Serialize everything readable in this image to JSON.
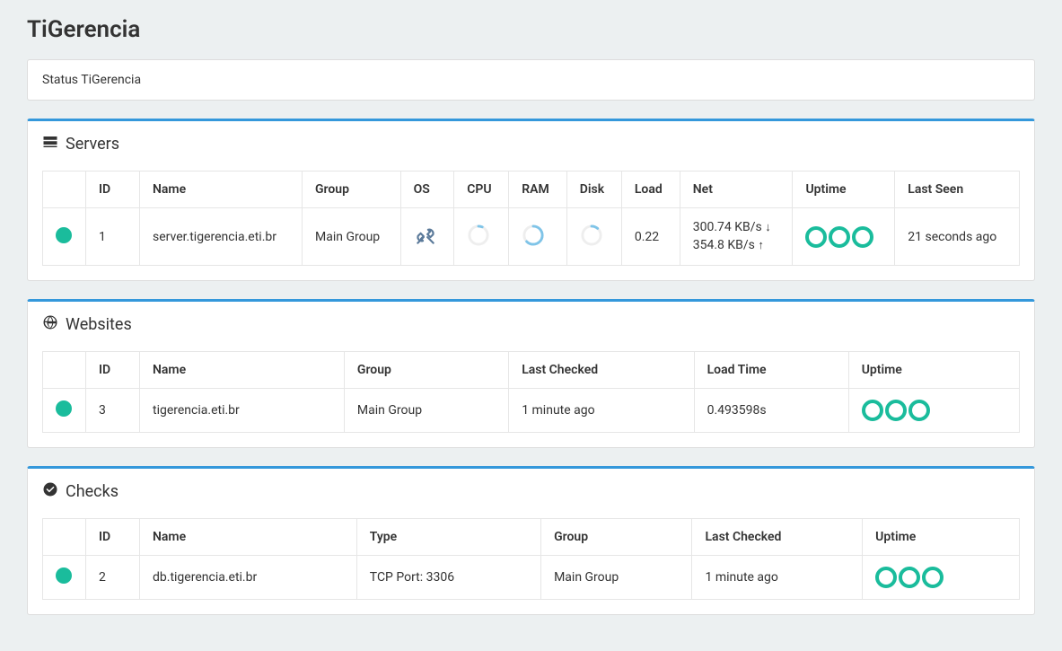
{
  "page": {
    "title": "TiGerencia",
    "status_label": "Status TiGerencia"
  },
  "servers_section": {
    "heading": "Servers",
    "columns": {
      "id": "ID",
      "name": "Name",
      "group": "Group",
      "os": "OS",
      "cpu": "CPU",
      "ram": "RAM",
      "disk": "Disk",
      "load": "Load",
      "net": "Net",
      "uptime": "Uptime",
      "last_seen": "Last Seen"
    },
    "rows": [
      {
        "id": "1",
        "name": "server.tigerencia.eti.br",
        "group": "Main Group",
        "load": "0.22",
        "net_down": "300.74 KB/s",
        "net_up": "354.8 KB/s",
        "last_seen": "21 seconds ago"
      }
    ]
  },
  "websites_section": {
    "heading": "Websites",
    "columns": {
      "id": "ID",
      "name": "Name",
      "group": "Group",
      "last_checked": "Last Checked",
      "load_time": "Load Time",
      "uptime": "Uptime"
    },
    "rows": [
      {
        "id": "3",
        "name": "tigerencia.eti.br",
        "group": "Main Group",
        "last_checked": "1 minute ago",
        "load_time": "0.493598s"
      }
    ]
  },
  "checks_section": {
    "heading": "Checks",
    "columns": {
      "id": "ID",
      "name": "Name",
      "type": "Type",
      "group": "Group",
      "last_checked": "Last Checked",
      "uptime": "Uptime"
    },
    "rows": [
      {
        "id": "2",
        "name": "db.tigerencia.eti.br",
        "type": "TCP Port: 3306",
        "group": "Main Group",
        "last_checked": "1 minute ago"
      }
    ]
  }
}
